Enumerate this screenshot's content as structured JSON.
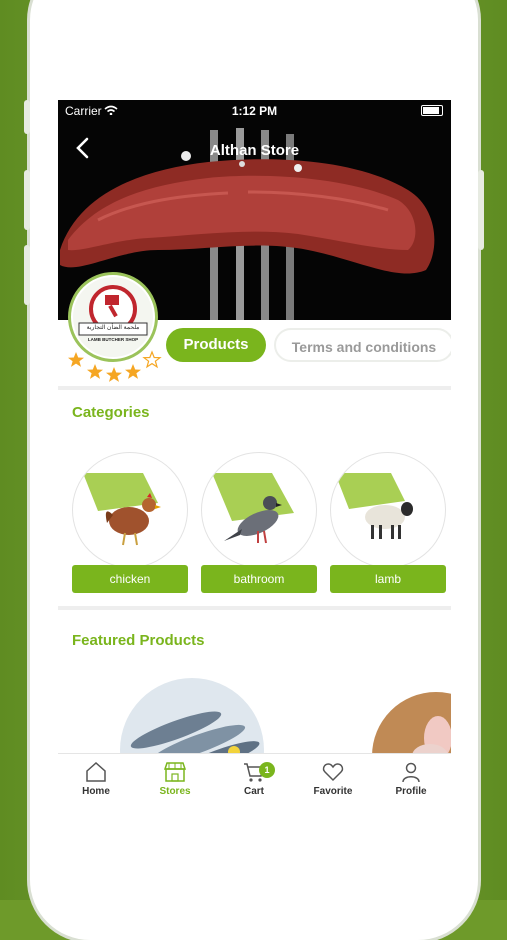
{
  "status_bar": {
    "carrier": "Carrier",
    "time": "1:12 PM"
  },
  "header": {
    "title": "Althan Store"
  },
  "store": {
    "logo_text_ar": "ملحمة الضأن التجارية",
    "logo_text_en": "LAMB BUTCHER SHOP",
    "rating": 4,
    "rating_max": 5
  },
  "tabs": [
    {
      "label": "Products",
      "active": true
    },
    {
      "label": "Terms and conditions",
      "active": false
    }
  ],
  "sections": {
    "categories_title": "Categories",
    "featured_title": "Featured Products"
  },
  "categories": [
    {
      "label": "chicken",
      "icon": "chicken-icon"
    },
    {
      "label": "bathroom",
      "icon": "pigeon-icon"
    },
    {
      "label": "lamb",
      "icon": "sheep-icon"
    }
  ],
  "tabbar": [
    {
      "label": "Home",
      "icon": "home-icon",
      "active": false
    },
    {
      "label": "Stores",
      "icon": "store-icon",
      "active": true
    },
    {
      "label": "Cart",
      "icon": "cart-icon",
      "active": false,
      "badge": "1"
    },
    {
      "label": "Favorite",
      "icon": "heart-icon",
      "active": false
    },
    {
      "label": "Profile",
      "icon": "profile-icon",
      "active": false
    }
  ],
  "colors": {
    "accent": "#7ab51d",
    "background": "#6e9a2a",
    "accent_light": "#a9cf54"
  }
}
